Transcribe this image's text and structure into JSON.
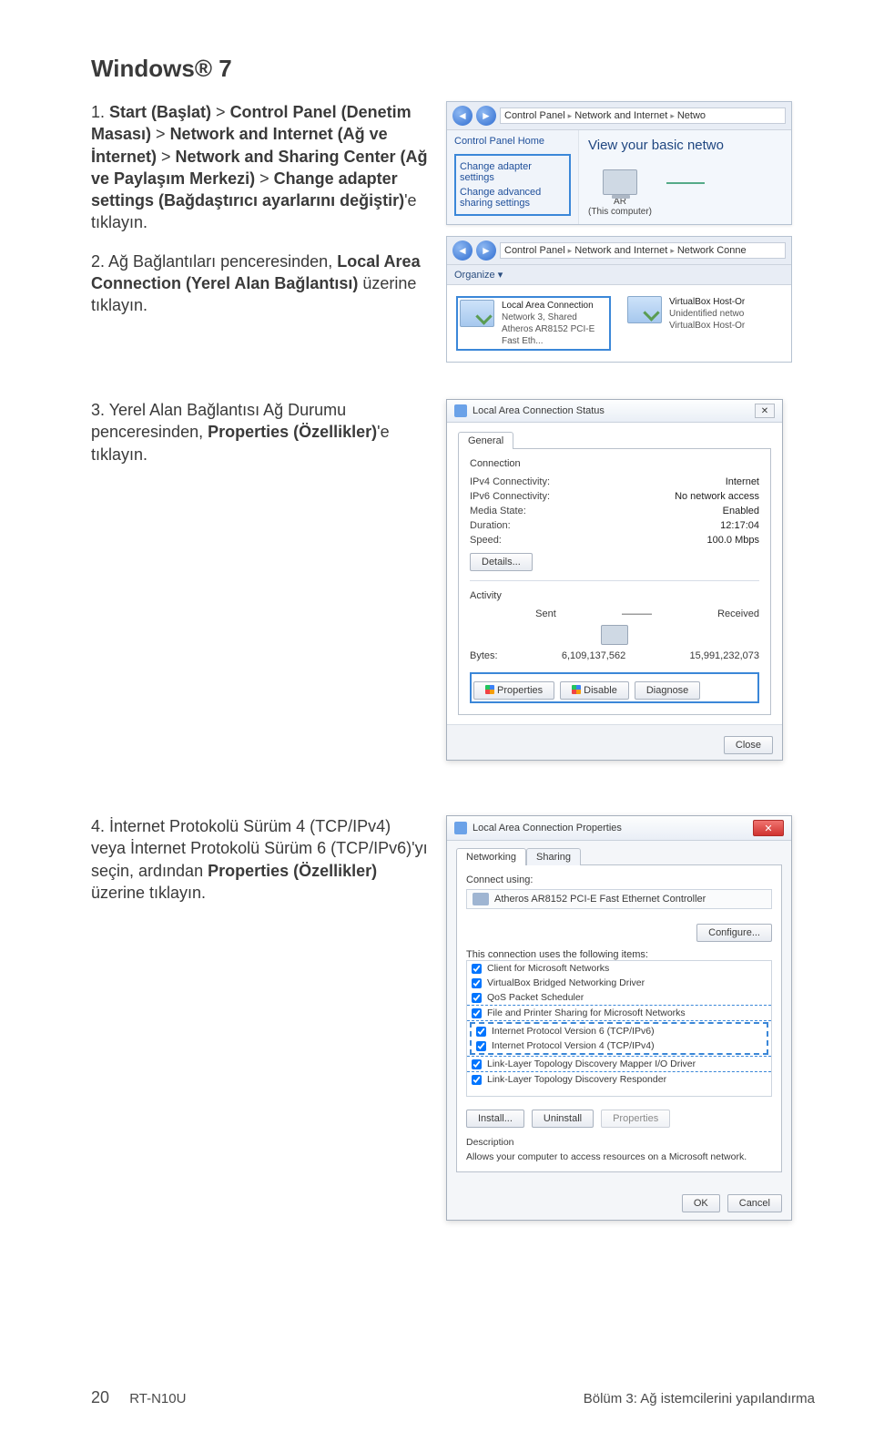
{
  "heading": "Windows® 7",
  "steps": {
    "s1": {
      "num": "1. ",
      "t1": "Start (Başlat)",
      "t2": " > ",
      "t3": "Control Panel (Denetim Masası)",
      "t4": " > ",
      "t5": "Network and Internet (Ağ ve İnternet)",
      "t6": " > ",
      "t7": "Network and Sharing Center (Ağ ve Paylaşım Merkezi)",
      "t8": " > ",
      "t9": "Change adapter settings (Bağdaştırıcı ayarlarını değiştir)",
      "t10": "'e tıklayın."
    },
    "s2": {
      "num": "2. ",
      "t1": "Ağ Bağlantıları penceresinden, ",
      "t2": "Local Area Connection (Yerel Alan Bağlantısı)",
      "t3": " üzerine tıklayın."
    },
    "s3": {
      "num": "3. ",
      "t1": "Yerel Alan Bağlantısı Ağ Durumu penceresinden, ",
      "t2": "Properties (Özellikler)",
      "t3": "'e tıklayın."
    },
    "s4": {
      "num": "4. ",
      "t1": "İnternet Protokolü Sürüm 4 (TCP/IPv4) veya İnternet Protokolü Sürüm 6 (TCP/IPv6)'yı seçin, ardından ",
      "t2": "Properties (Özellikler)",
      "t3": " üzerine tıklayın."
    }
  },
  "cp": {
    "crumb1": "Control Panel",
    "crumb2": "Network and Internet",
    "crumb3": "Netwo",
    "home": "Control Panel Home",
    "link1": "Change adapter settings",
    "link2": "Change advanced sharing settings",
    "mainTitle": "View your basic netwo",
    "pcName": "AR",
    "pcSub": "(This computer)"
  },
  "nc": {
    "crumb2b": "Network Conne",
    "organize": "Organize ▾",
    "item1": {
      "name": "Local Area Connection",
      "l2": "Network 3, Shared",
      "l3": "Atheros AR8152 PCI-E Fast Eth..."
    },
    "item2": {
      "name": "VirtualBox Host-Or",
      "l2": "Unidentified netwo",
      "l3": "VirtualBox Host-Or"
    }
  },
  "status": {
    "title": "Local Area Connection Status",
    "tab": "General",
    "conn": "Connection",
    "rows": {
      "ipv4k": "IPv4 Connectivity:",
      "ipv4v": "Internet",
      "ipv6k": "IPv6 Connectivity:",
      "ipv6v": "No network access",
      "mediak": "Media State:",
      "mediav": "Enabled",
      "durk": "Duration:",
      "durv": "12:17:04",
      "spdk": "Speed:",
      "spdv": "100.0 Mbps"
    },
    "details": "Details...",
    "activity": "Activity",
    "sent": "Sent",
    "recv": "Received",
    "dash": "———",
    "bytesk": "Bytes:",
    "bv1": "6,109,137,562",
    "bv2": "15,991,232,073",
    "btnProp": "Properties",
    "btnDis": "Disable",
    "btnDiag": "Diagnose",
    "close": "Close"
  },
  "prop": {
    "title": "Local Area Connection Properties",
    "tab1": "Networking",
    "tab2": "Sharing",
    "connUsing": "Connect using:",
    "nic": "Atheros AR8152 PCI-E Fast Ethernet Controller",
    "configure": "Configure...",
    "usesItems": "This connection uses the following items:",
    "items": [
      "Client for Microsoft Networks",
      "VirtualBox Bridged Networking Driver",
      "QoS Packet Scheduler",
      "File and Printer Sharing for Microsoft Networks",
      "Internet Protocol Version 6 (TCP/IPv6)",
      "Internet Protocol Version 4 (TCP/IPv4)",
      "Link-Layer Topology Discovery Mapper I/O Driver",
      "Link-Layer Topology Discovery Responder"
    ],
    "install": "Install...",
    "uninstall": "Uninstall",
    "properties": "Properties",
    "descLabel": "Description",
    "desc": "Allows your computer to access resources on a Microsoft network.",
    "ok": "OK",
    "cancel": "Cancel"
  },
  "footer": {
    "page": "20",
    "model": "RT-N10U",
    "chapter": "Bölüm 3: Ağ istemcilerini yapılandırma"
  }
}
